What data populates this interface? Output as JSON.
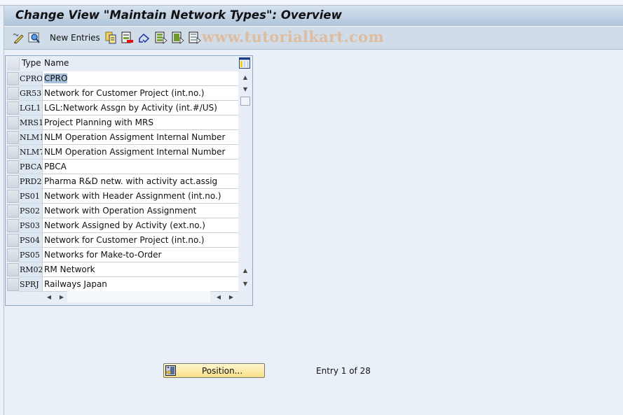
{
  "window": {
    "title": "Change View \"Maintain Network Types\": Overview"
  },
  "toolbar": {
    "new_entries_label": "New Entries",
    "icons": [
      "display-change-icon",
      "details-icon",
      "copy-as-icon",
      "delete-icon",
      "undo-change-icon",
      "select-all-icon",
      "select-block-icon",
      "deselect-all-icon"
    ]
  },
  "watermark": "www.tutorialkart.com",
  "table": {
    "columns": [
      "Type",
      "Name"
    ],
    "rows": [
      {
        "type": "CPRO",
        "name": "CPRO"
      },
      {
        "type": "GR53",
        "name": "Network for Customer Project (int.no.)"
      },
      {
        "type": "LGL1",
        "name": "LGL:Network Assgn by Activity (int.#/US)"
      },
      {
        "type": "MRS1",
        "name": "Project Planning with MRS"
      },
      {
        "type": "NLM1",
        "name": "NLM Operation Assigment  Internal Number"
      },
      {
        "type": "NLM7",
        "name": "NLM Operation Assigment  Internal Number"
      },
      {
        "type": "PBCA",
        "name": "PBCA"
      },
      {
        "type": "PRD2",
        "name": "Pharma R&D netw. with activity act.assig"
      },
      {
        "type": "PS01",
        "name": "Network with Header Assignment (int.no.)"
      },
      {
        "type": "PS02",
        "name": "Network with Operation Assignment"
      },
      {
        "type": "PS03",
        "name": "Network Assigned by Activity (ext.no.)"
      },
      {
        "type": "PS04",
        "name": "Network for Customer Project (int.no.)"
      },
      {
        "type": "PS05",
        "name": "Networks for Make-to-Order"
      },
      {
        "type": "RM02",
        "name": "RM Network"
      },
      {
        "type": "SPRJ",
        "name": "Railways Japan"
      }
    ]
  },
  "footer": {
    "position_label": "Position...",
    "entry_text": "Entry 1 of 28"
  }
}
